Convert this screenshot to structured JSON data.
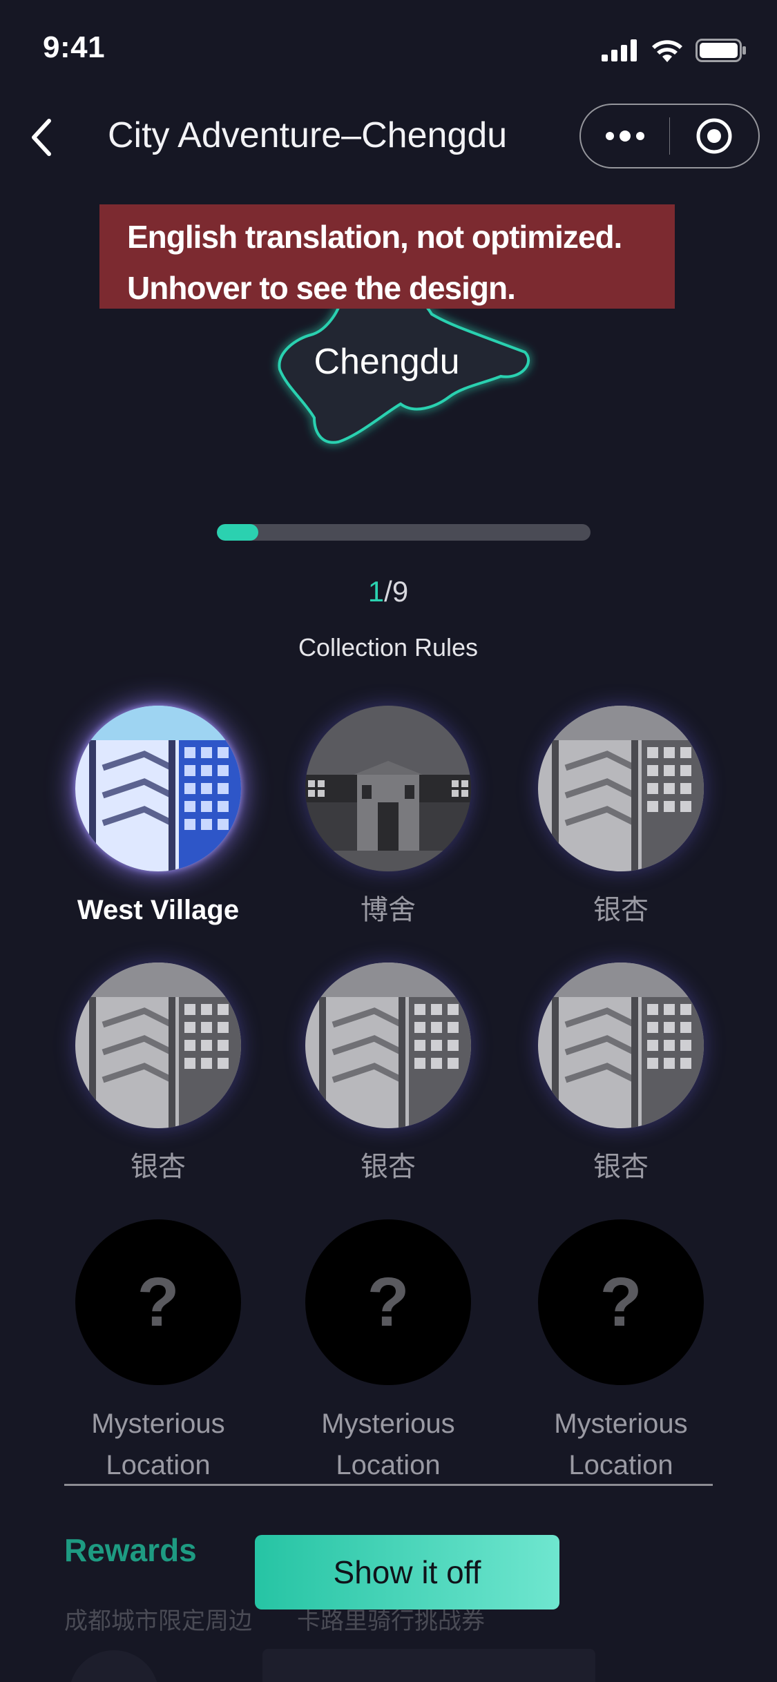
{
  "status_bar": {
    "time": "9:41",
    "icons": [
      "signal-icon",
      "wifi-icon",
      "battery-icon"
    ]
  },
  "nav": {
    "title": "City Adventure–Chengdu",
    "back_icon": "chevron-left-icon",
    "menu_icon": "more-icon",
    "close_icon": "target-icon"
  },
  "banner": {
    "line1": "English translation, not optimized.",
    "line2": "Unhover to see the design."
  },
  "map": {
    "label": "Chengdu",
    "glow_color": "#2bd1b0"
  },
  "progress": {
    "current": "1",
    "separator": "/",
    "total": "9",
    "fraction": 0.111,
    "accent": "#2bd1b0"
  },
  "rules_link": "Collection Rules",
  "locations": [
    {
      "label": "West Village",
      "state": "active"
    },
    {
      "label": "博舍",
      "state": "collected"
    },
    {
      "label": "银杏",
      "state": "collected"
    },
    {
      "label": "银杏",
      "state": "collected"
    },
    {
      "label": "银杏",
      "state": "collected"
    },
    {
      "label": "银杏",
      "state": "collected"
    },
    {
      "label": "Mysterious Location",
      "state": "locked"
    },
    {
      "label": "Mysterious Location",
      "state": "locked"
    },
    {
      "label": "Mysterious Location",
      "state": "locked"
    }
  ],
  "mystery_symbol": "?",
  "rewards": {
    "title": "Rewards",
    "items": [
      "成都城市限定周边",
      "卡路里骑行挑战券"
    ]
  },
  "cta": {
    "label": "Show it off"
  }
}
